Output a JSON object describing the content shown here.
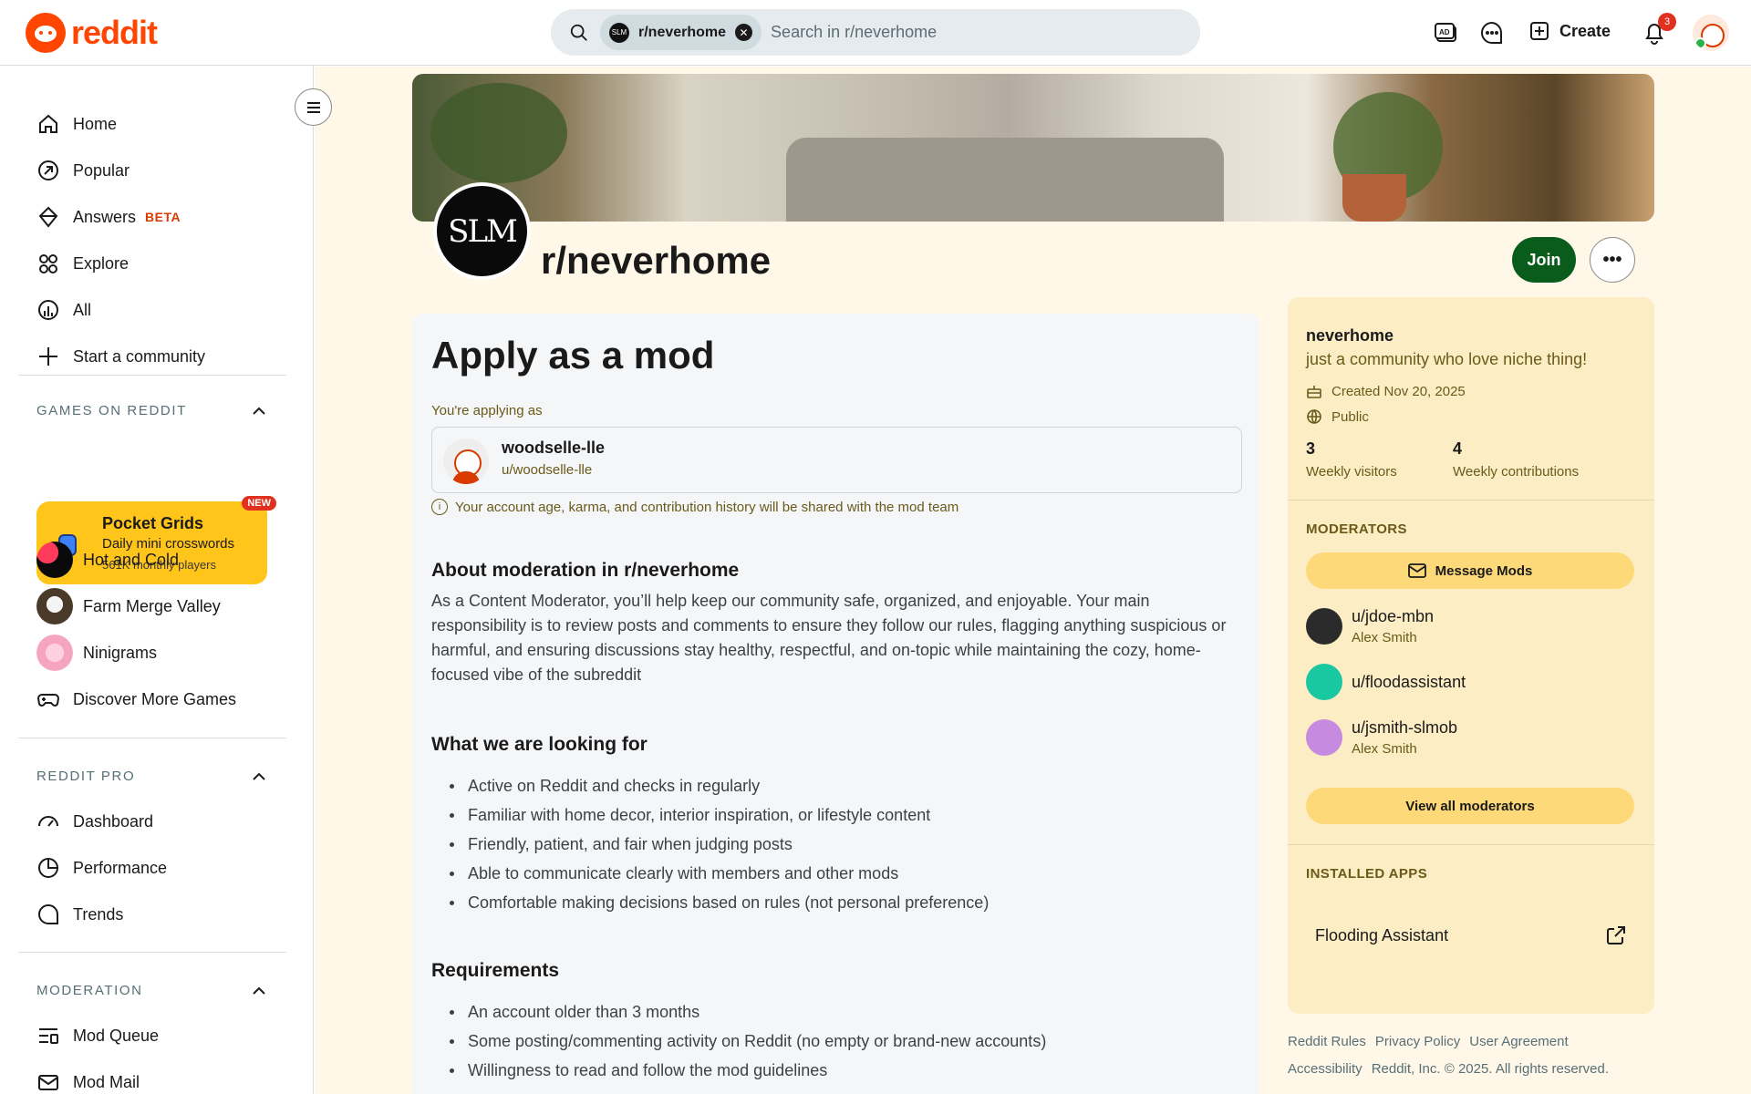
{
  "header": {
    "logo_text": "reddit",
    "search_chip": "r/neverhome",
    "chip_avatar_text": "SLM",
    "search_placeholder": "Search in r/neverhome",
    "create_label": "Create",
    "notification_count": "3",
    "icons": [
      "advertise-icon",
      "chat-icon",
      "create-icon",
      "bell-icon"
    ]
  },
  "sidebar": {
    "nav": [
      {
        "label": "Home",
        "icon": "home-icon"
      },
      {
        "label": "Popular",
        "icon": "popular-icon"
      },
      {
        "label": "Answers",
        "badge": "BETA",
        "icon": "answers-icon"
      },
      {
        "label": "Explore",
        "icon": "explore-icon"
      },
      {
        "label": "All",
        "icon": "all-icon"
      },
      {
        "label": "Start a community",
        "icon": "plus-icon"
      }
    ],
    "games_section": "GAMES ON REDDIT",
    "promo": {
      "new_badge": "NEW",
      "title": "Pocket Grids",
      "subtitle": "Daily mini crosswords",
      "players": "561K monthly players"
    },
    "games": [
      {
        "label": "Hot and Cold"
      },
      {
        "label": "Farm Merge Valley"
      },
      {
        "label": "Ninigrams"
      },
      {
        "label": "Discover More Games"
      }
    ],
    "pro_section": "REDDIT PRO",
    "pro": [
      {
        "label": "Dashboard"
      },
      {
        "label": "Performance"
      },
      {
        "label": "Trends"
      }
    ],
    "moderation_section": "MODERATION",
    "moderation": [
      {
        "label": "Mod Queue"
      },
      {
        "label": "Mod Mail"
      }
    ]
  },
  "community": {
    "avatar_text": "SLM",
    "name": "r/neverhome",
    "join_label": "Join",
    "more_label": "•••"
  },
  "apply": {
    "title": "Apply as a mod",
    "applying_label": "You're applying as",
    "username": "woodselle-lle",
    "handle": "u/woodselle-lle",
    "notice": "Your account age, karma, and contribution history will be shared with the mod team",
    "about_heading": "About moderation in r/neverhome",
    "about_text": "As a Content Moderator, you’ll help keep our community safe, organized, and enjoyable. Your main responsibility is to review posts and comments to ensure they follow our rules, flagging anything suspicious or harmful, and ensuring discussions stay healthy, respectful, and on-topic while maintaining the cozy, home-focused vibe of the subreddit",
    "looking_heading": "What we are looking for",
    "looking": [
      "Active on Reddit and checks in regularly",
      "Familiar with home decor, interior inspiration, or lifestyle content",
      "Friendly, patient, and fair when judging posts",
      "Able to communicate clearly with members and other mods",
      "Comfortable making decisions based on rules (not personal preference)"
    ],
    "requirements_heading": "Requirements",
    "requirements": [
      "An account older than 3 months",
      "Some posting/commenting activity on Reddit (no empty or brand-new accounts)",
      "Willingness to read and follow the mod guidelines"
    ]
  },
  "panel": {
    "name": "neverhome",
    "description": "just a community who love niche thing!",
    "created": "Created Nov 20, 2025",
    "visibility": "Public",
    "visitors_value": "3",
    "visitors_label": "Weekly visitors",
    "contrib_value": "4",
    "contrib_label": "Weekly contributions",
    "moderators_heading": "MODERATORS",
    "message_mods": "Message Mods",
    "mods": [
      {
        "name": "u/jdoe-mbn",
        "sub": "Alex Smith",
        "color": "#2b2b2b"
      },
      {
        "name": "u/floodassistant",
        "sub": "",
        "color": "#19c8a0"
      },
      {
        "name": "u/jsmith-slmob",
        "sub": "Alex Smith",
        "color": "#c68be0"
      }
    ],
    "view_all": "View all moderators",
    "apps_heading": "INSTALLED APPS",
    "app_name": "Flooding Assistant"
  },
  "footer": {
    "links1": [
      "Reddit Rules",
      "Privacy Policy",
      "User Agreement"
    ],
    "links2": [
      "Accessibility",
      "Reddit, Inc. © 2025. All rights reserved."
    ]
  },
  "colors": {
    "brand": "#ff4500",
    "join": "#0a5c1c",
    "panel": "#fdedc4",
    "page_bg": "#fff8e8"
  }
}
